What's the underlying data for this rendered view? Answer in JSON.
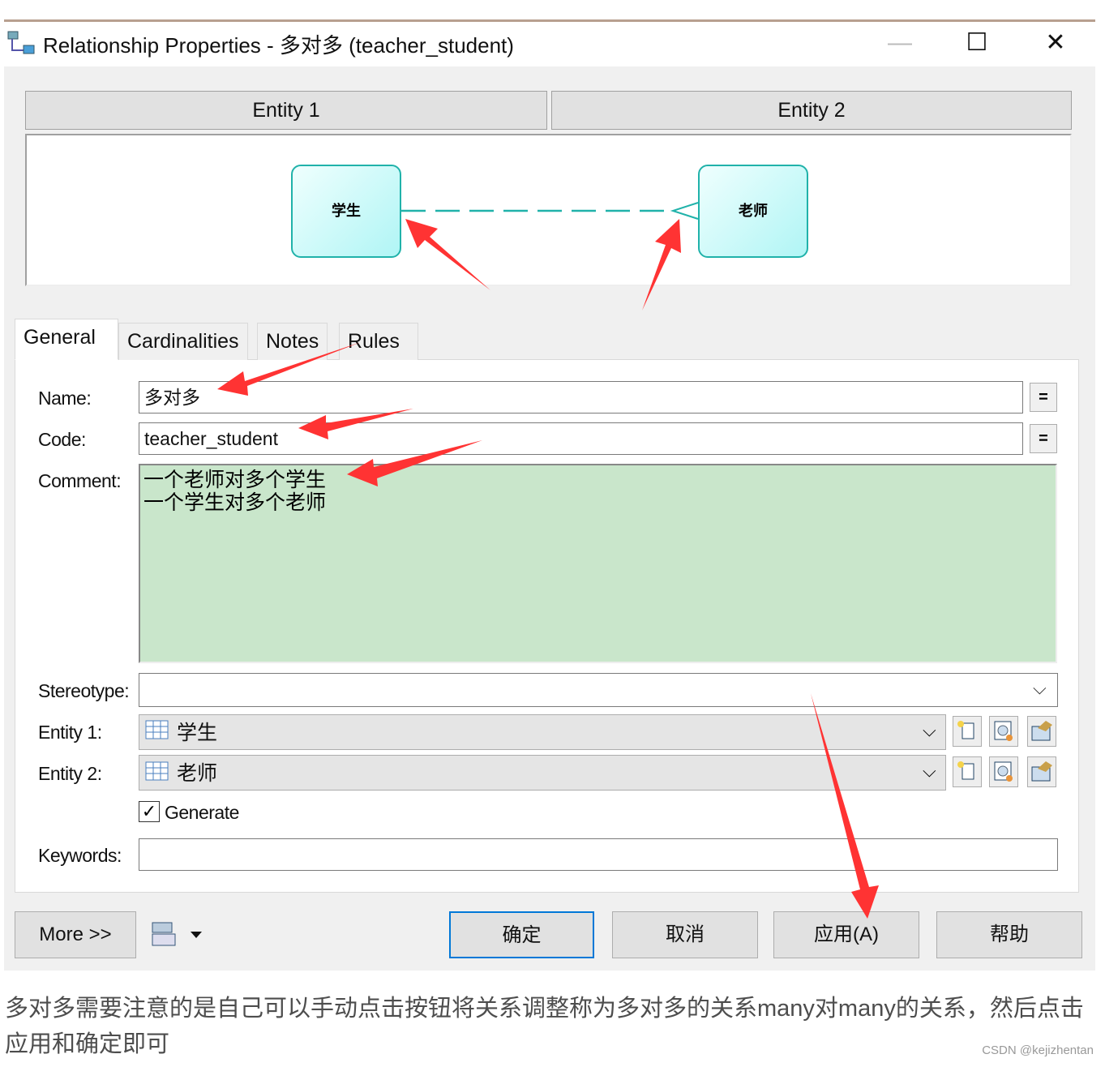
{
  "window": {
    "title": "Relationship Properties - 多对多 (teacher_student)",
    "icon": "relationship-icon",
    "minimize": "—",
    "maximize": "☐",
    "close": "✕"
  },
  "diagram": {
    "entity1_header": "Entity 1",
    "entity2_header": "Entity 2",
    "entity1_name": "学生",
    "entity2_name": "老师",
    "line_color": "#20b2aa"
  },
  "tabs": [
    {
      "label": "General",
      "active": true
    },
    {
      "label": "Cardinalities"
    },
    {
      "label": "Notes"
    },
    {
      "label": "Rules"
    }
  ],
  "form": {
    "name_label": "Name:",
    "name_value": "多对多",
    "code_label": "Code:",
    "code_value": "teacher_student",
    "eq_label": "=",
    "comment_label": "Comment:",
    "comment_lines": [
      "一个老师对多个学生",
      "一个学生对多个老师"
    ],
    "stereotype_label": "Stereotype:",
    "stereotype_value": "",
    "entity1_label": "Entity 1:",
    "entity1_value": "学生",
    "entity2_label": "Entity 2:",
    "entity2_value": "老师",
    "generate_label": "Generate",
    "generate_checked": true,
    "keywords_label": "Keywords:",
    "keywords_value": ""
  },
  "buttons": {
    "more": "More >>",
    "ok": "确定",
    "cancel": "取消",
    "apply": "应用(A)",
    "help": "帮助"
  },
  "annotation_color": "#ff3333",
  "caption": "多对多需要注意的是自己可以手动点击按钮将关系调整称为多对多的关系many对many的关系，然后点击应用和确定即可",
  "watermark": "CSDN @kejizhentan"
}
